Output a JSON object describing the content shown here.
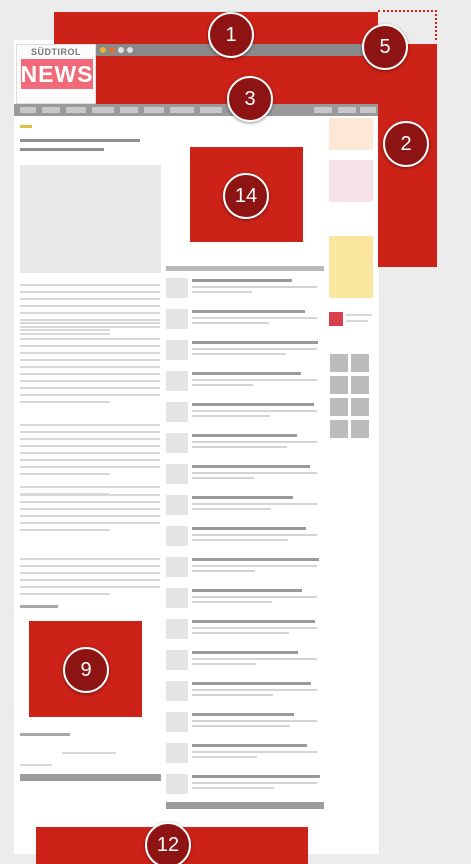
{
  "logo": {
    "top_text": "SÜDTIROL",
    "main_text": "NEWS"
  },
  "callouts": [
    "1",
    "2",
    "3",
    "5",
    "9",
    "12",
    "14"
  ],
  "colors": {
    "highlight_red": "#cc2218",
    "badge_red": "#8e1414",
    "logo_pink": "#f06a7a"
  }
}
